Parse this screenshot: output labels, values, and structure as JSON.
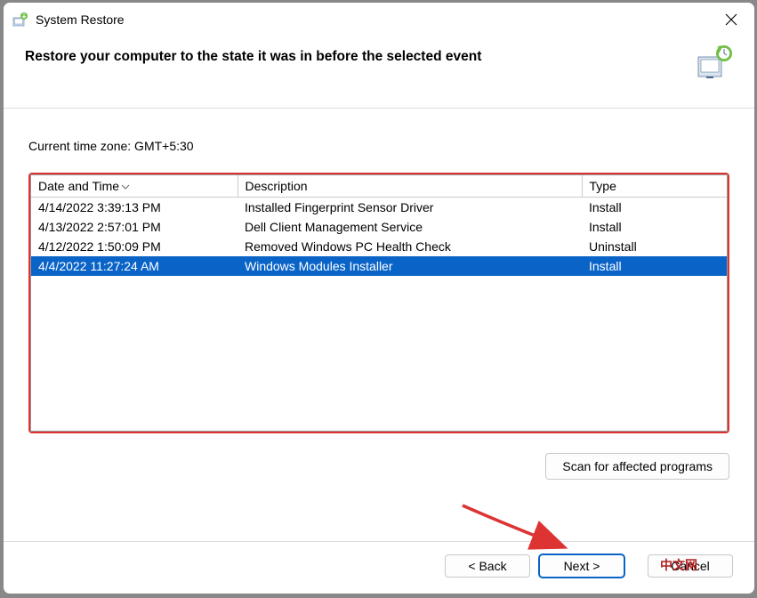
{
  "window": {
    "title": "System Restore"
  },
  "header": {
    "heading": "Restore your computer to the state it was in before the selected event"
  },
  "timezone_label": "Current time zone: GMT+5:30",
  "columns": {
    "date": "Date and Time",
    "desc": "Description",
    "type": "Type"
  },
  "rows": [
    {
      "date": "4/14/2022 3:39:13 PM",
      "desc": "Installed Fingerprint Sensor Driver",
      "type": "Install",
      "selected": false
    },
    {
      "date": "4/13/2022 2:57:01 PM",
      "desc": "Dell Client Management Service",
      "type": "Install",
      "selected": false
    },
    {
      "date": "4/12/2022 1:50:09 PM",
      "desc": "Removed Windows PC Health Check",
      "type": "Uninstall",
      "selected": false
    },
    {
      "date": "4/4/2022 11:27:24 AM",
      "desc": "Windows Modules Installer",
      "type": "Install",
      "selected": true
    }
  ],
  "buttons": {
    "scan": "Scan for affected programs",
    "back": "< Back",
    "next": "Next >",
    "cancel": "Cancel",
    "cancel_overlay": "中文网"
  }
}
